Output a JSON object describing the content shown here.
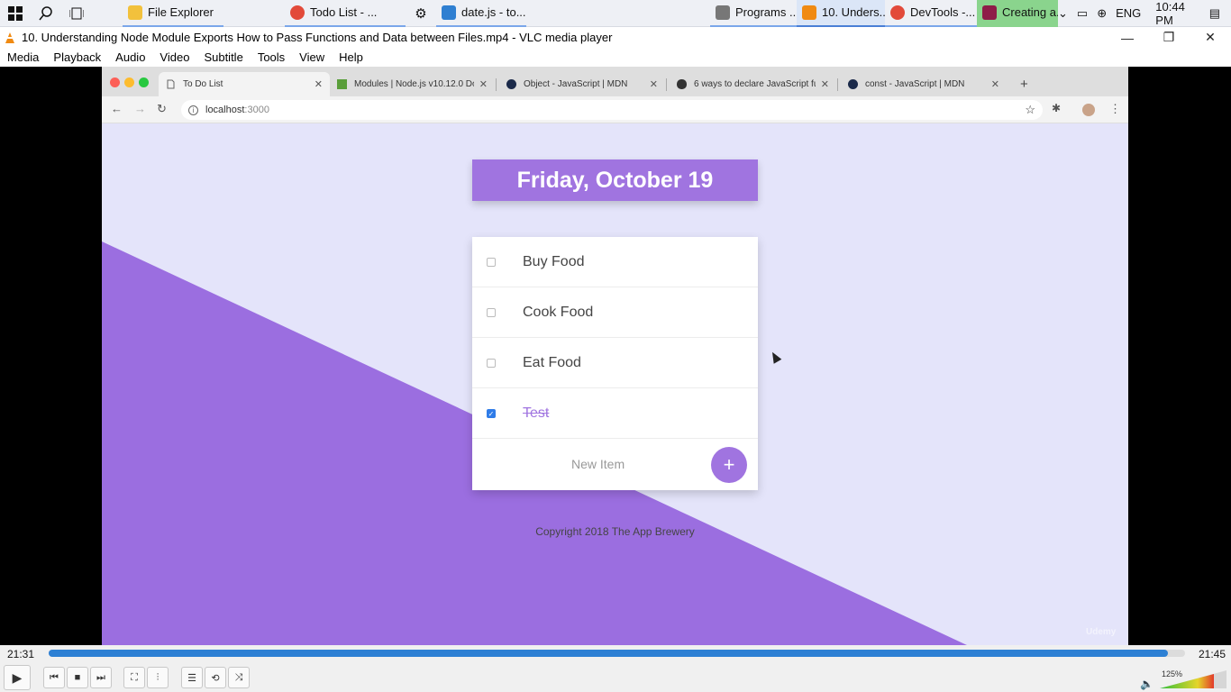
{
  "taskbar": {
    "items": [
      {
        "label": "File Explorer"
      },
      {
        "label": "Todo List - ..."
      },
      {
        "label": "date.js - to..."
      },
      {
        "label": "Programs ..."
      },
      {
        "label": "10. Unders..."
      },
      {
        "label": "DevTools -..."
      },
      {
        "label": "Creating a..."
      }
    ],
    "language": "ENG",
    "clock": "10:44 PM"
  },
  "vlc": {
    "title": "10. Understanding Node Module Exports How to Pass Functions and Data between Files.mp4 - VLC media player",
    "menu": [
      "Media",
      "Playback",
      "Audio",
      "Video",
      "Subtitle",
      "Tools",
      "View",
      "Help"
    ],
    "time_elapsed": "21:31",
    "time_total": "21:45",
    "progress": 0.985,
    "volume_label": "125%"
  },
  "browser": {
    "tabs": [
      {
        "label": "To Do List"
      },
      {
        "label": "Modules | Node.js v10.12.0 Doc"
      },
      {
        "label": "Object - JavaScript | MDN"
      },
      {
        "label": "6 ways to declare JavaScript fu"
      },
      {
        "label": "const - JavaScript | MDN"
      }
    ],
    "url_host": "localhost",
    "url_port": ":3000"
  },
  "app": {
    "heading": "Friday, October 19",
    "items": [
      {
        "label": "Buy Food",
        "checked": false
      },
      {
        "label": "Cook Food",
        "checked": false
      },
      {
        "label": "Eat Food",
        "checked": false
      },
      {
        "label": "Test",
        "checked": true
      }
    ],
    "new_item_placeholder": "New Item",
    "add_label": "+",
    "footer": "Copyright 2018 The App Brewery",
    "watermark": "Udemy"
  }
}
